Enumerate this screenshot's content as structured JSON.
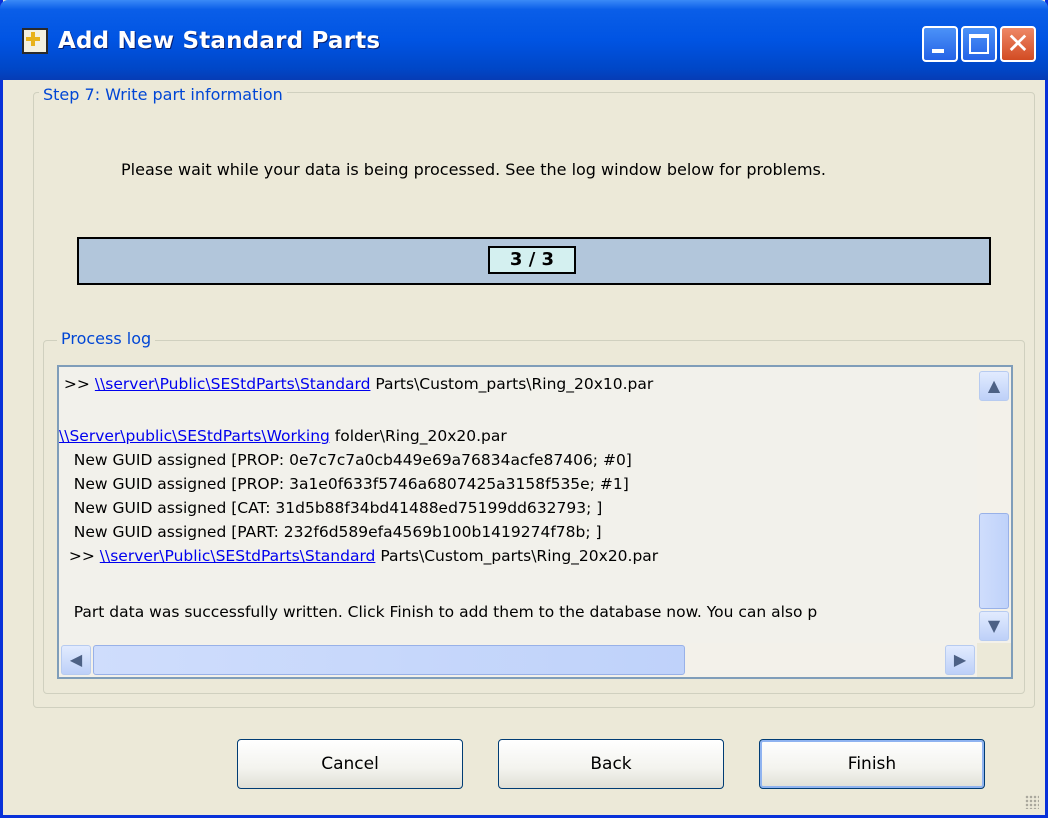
{
  "window": {
    "title": "Add New Standard Parts",
    "icon": "add-parts-app-icon",
    "controls": {
      "minimize": "minimize-icon",
      "maximize": "maximize-icon",
      "close": "close-icon"
    }
  },
  "step": {
    "legend": "Step 7: Write part information",
    "message": "Please wait while your data is being processed. See the log window below for problems."
  },
  "progress": {
    "label": "3 / 3",
    "current": 3,
    "total": 3,
    "fraction": 1.0,
    "bar_color": "#B2C6DB"
  },
  "log": {
    "legend": "Process log",
    "lines": [
      {
        "prefix": " >> ",
        "link": "\\\\server\\Public\\SEStdParts\\Standard",
        "rest": " Parts\\Custom_parts\\Ring_20x10.par"
      },
      {
        "prefix": "",
        "link": "",
        "rest": ""
      },
      {
        "prefix": "",
        "link": "\\\\Server\\public\\SEStdParts\\Working",
        "rest": " folder\\Ring_20x20.par"
      },
      {
        "prefix": "   New GUID assigned [PROP: 0e7c7c7a0cb449e69a76834acfe87406; #0]",
        "link": "",
        "rest": ""
      },
      {
        "prefix": "   New GUID assigned [PROP: 3a1e0f633f5746a6807425a3158f535e; #1]",
        "link": "",
        "rest": ""
      },
      {
        "prefix": "   New GUID assigned [CAT: 31d5b88f34bd41488ed75199dd632793; ]",
        "link": "",
        "rest": ""
      },
      {
        "prefix": "   New GUID assigned [PART: 232f6d589efa4569b100b1419274f78b; ]",
        "link": "",
        "rest": ""
      },
      {
        "prefix": "  >> ",
        "link": "\\\\server\\Public\\SEStdParts\\Standard",
        "rest": " Parts\\Custom_parts\\Ring_20x20.par"
      },
      {
        "prefix": "",
        "link": "",
        "rest": ""
      },
      {
        "prefix": "   Part data was successfully written. Click Finish to add them to the database now. You can also p",
        "link": "",
        "rest": ""
      }
    ],
    "scroll_icons": {
      "up": "scroll-up-icon",
      "down": "scroll-down-icon",
      "left": "scroll-left-icon",
      "right": "scroll-right-icon"
    }
  },
  "buttons": {
    "cancel": "Cancel",
    "back": "Back",
    "finish": "Finish"
  },
  "colors": {
    "titlebar": "#0054E3",
    "window_bg": "#ECE9D8",
    "legend_text": "#0046D5",
    "link": "#0000EE"
  }
}
